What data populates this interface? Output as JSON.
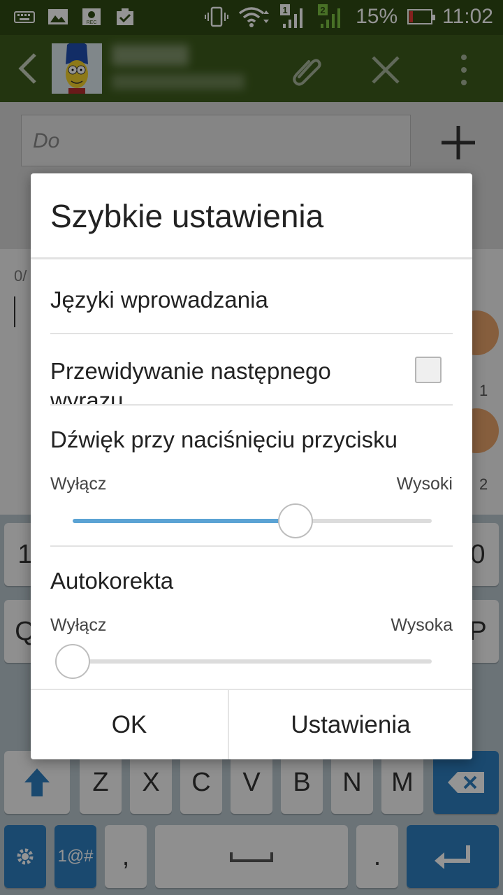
{
  "status_bar": {
    "battery_percent": "15%",
    "time": "11:02",
    "sim1": "1",
    "sim2": "2",
    "icons": [
      "keyboard-icon",
      "image-icon",
      "rec-icon",
      "clipboard-check-icon",
      "vibrate-icon",
      "wifi-icon",
      "signal-icon",
      "battery-icon"
    ]
  },
  "action_bar": {
    "icons": [
      "back-arrow-icon",
      "contact-avatar",
      "paperclip-icon",
      "close-icon",
      "overflow-menu-icon"
    ]
  },
  "compose": {
    "to_placeholder": "Do",
    "char_counter": "0/",
    "sim_labels": [
      "1",
      "2"
    ]
  },
  "dialog": {
    "title": "Szybkie ustawienia",
    "input_languages": "Języki wprowadzania",
    "next_word_prediction": "Przewidywanie następnego wyrazu",
    "next_word_prediction_checked": false,
    "key_sound": {
      "label": "Dźwięk przy naciśnięciu przycisku",
      "min_label": "Wyłącz",
      "max_label": "Wysoki",
      "level": 0.62
    },
    "autocorrect": {
      "label": "Autokorekta",
      "min_label": "Wyłącz",
      "max_label": "Wysoka",
      "level": 0.0
    },
    "ok_label": "OK",
    "settings_label": "Ustawienia"
  },
  "keyboard": {
    "row1_edges": [
      "1",
      "0"
    ],
    "row2_edges": [
      "Q",
      "P"
    ],
    "row3": [
      "Z",
      "X",
      "C",
      "V",
      "B",
      "N",
      "M"
    ],
    "symbols_label": "1@#",
    "comma": ",",
    "period": "."
  },
  "colors": {
    "status_bar": "#2f4a14",
    "action_bar": "#3d5c1c",
    "slider_fill": "#5ba3d4",
    "keyboard_accent": "#2e7fc0"
  }
}
